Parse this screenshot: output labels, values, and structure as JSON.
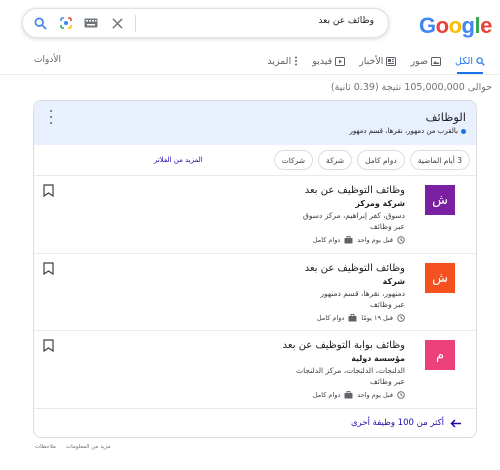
{
  "header": {
    "logo_letters": [
      {
        "ch": "G",
        "color": "#4285f4"
      },
      {
        "ch": "o",
        "color": "#ea4335"
      },
      {
        "ch": "o",
        "color": "#fbbc05"
      },
      {
        "ch": "g",
        "color": "#4285f4"
      },
      {
        "ch": "l",
        "color": "#34a853"
      },
      {
        "ch": "e",
        "color": "#ea4335"
      }
    ],
    "search_query": "وظائف عن بعد",
    "icons": [
      "search-icon",
      "lens-icon",
      "keyboard-icon",
      "clear-icon"
    ]
  },
  "tabs": [
    {
      "label": "الكل",
      "icon": "search-icon",
      "active": true
    },
    {
      "label": "صور",
      "icon": "image-icon",
      "active": false
    },
    {
      "label": "الأخبار",
      "icon": "news-icon",
      "active": false
    },
    {
      "label": "فيديو",
      "icon": "video-icon",
      "active": false
    },
    {
      "label": "المزيد",
      "icon": "more-icon",
      "active": false
    }
  ],
  "tools_label": "الأدوات",
  "result_stats": "حوالى 105,000,000 نتيجة (0.39 ثانية)",
  "jobs_card": {
    "title": "الوظائف",
    "location": "بالقرب من دمهور، نقرها، قسم دمهور",
    "chips": [
      "3 أيام الماضية",
      "دوام كامل",
      "شركة",
      "شركات"
    ],
    "more_filters": "المزيد من الفلاتر",
    "jobs": [
      {
        "logo_letter": "ش",
        "logo_color": "#7b1fa2",
        "title": "وظائف التوظيف عن بعد",
        "company": "شركة ومركز",
        "location": "دسوق، كفر إبراهيم، مركز دسوق",
        "via": "عبر وظائف",
        "posted": "قبل يوم واحد",
        "type": "دوام كامل"
      },
      {
        "logo_letter": "ش",
        "logo_color": "#f4511e",
        "title": "وظائف التوظيف عن بعد",
        "company": "شركة",
        "location": "دمنهور، نقرها، قسم دمنهور",
        "via": "عبر وظائف",
        "posted": "قبل ١٩ يومًا",
        "type": "دوام كامل"
      },
      {
        "logo_letter": "م",
        "logo_color": "#ec407a",
        "title": "وظائف بوابة التوظيف عن بعد",
        "company": "مؤسسة دولية",
        "location": "الدلنجات، الدلنجات، مركز الدلنجات",
        "via": "عبر وظائف",
        "posted": "قبل يوم واحد",
        "type": "دوام كامل"
      }
    ],
    "more_jobs": "أكثر من 100 وظيفة أخرى"
  },
  "footer": {
    "more_info": "مزيد من المعلومات",
    "feedback": "ملاحظات"
  }
}
